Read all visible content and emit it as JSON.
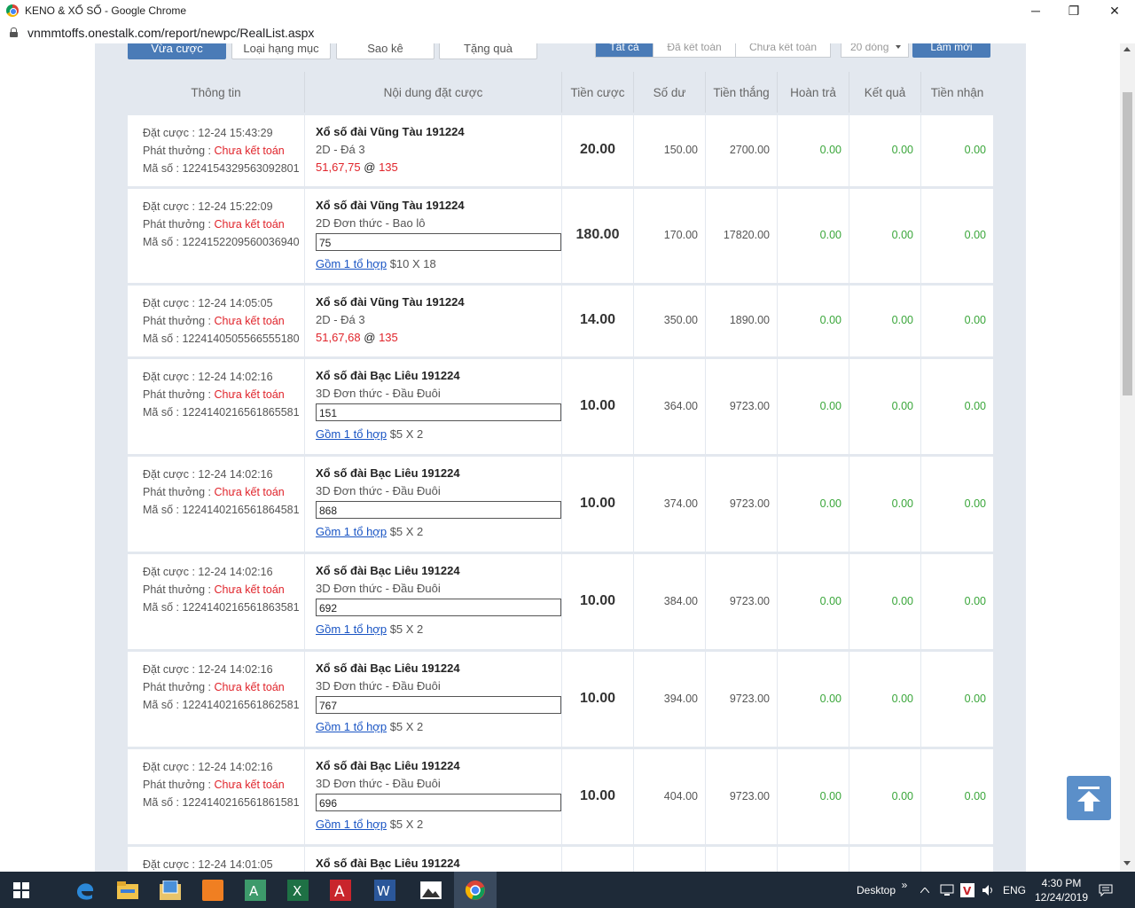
{
  "window": {
    "title": "KENO & XỔ SỐ - Google Chrome",
    "minimize": "─",
    "restore": "❐",
    "close": "✕"
  },
  "address": {
    "url": "vnmmtoffs.onestalk.com/report/newpc/RealList.aspx"
  },
  "toolbar": {
    "buttons": [
      "Vừa cược",
      "Loại hạng mục",
      "Sao kê",
      "Tặng quà"
    ],
    "filters": [
      "Tất cả",
      "Đã kết toán",
      "Chưa kết toán"
    ],
    "page_size": "20 dòng",
    "refresh": "Làm mới"
  },
  "table": {
    "headers": [
      "Thông tin",
      "Nội dung đặt cược",
      "Tiền cược",
      "Số dư",
      "Tiền thắng",
      "Hoàn trả",
      "Kết quả",
      "Tiền nhận"
    ],
    "labels": {
      "time": "Đặt cược : ",
      "payout": "Phát thưởng : ",
      "code": "Mã số : ",
      "unsettled": "Chưa kết toán",
      "at": "@",
      "combo": "Gồm 1 tổ hợp"
    },
    "rows": [
      {
        "time": "12-24 15:43:29",
        "code": "1224154329563092801",
        "title": "Xổ số đài Vũng Tàu 191224",
        "type": "2D - Đá 3",
        "numbers": "51,67,75",
        "odds": "135",
        "box": "",
        "combo_detail": "",
        "bet": "20.00",
        "balance": "150.00",
        "win": "2700.00",
        "refund": "0.00",
        "result": "0.00",
        "received": "0.00"
      },
      {
        "time": "12-24 15:22:09",
        "code": "1224152209560036940",
        "title": "Xổ số đài Vũng Tàu 191224",
        "type": "2D Đơn thức - Bao lô",
        "numbers": "",
        "odds": "",
        "box": "75",
        "combo_detail": "$10 X 18",
        "bet": "180.00",
        "balance": "170.00",
        "win": "17820.00",
        "refund": "0.00",
        "result": "0.00",
        "received": "0.00"
      },
      {
        "time": "12-24 14:05:05",
        "code": "1224140505566555180",
        "title": "Xổ số đài Vũng Tàu 191224",
        "type": "2D - Đá 3",
        "numbers": "51,67,68",
        "odds": "135",
        "box": "",
        "combo_detail": "",
        "bet": "14.00",
        "balance": "350.00",
        "win": "1890.00",
        "refund": "0.00",
        "result": "0.00",
        "received": "0.00"
      },
      {
        "time": "12-24 14:02:16",
        "code": "1224140216561865581",
        "title": "Xổ số đài Bạc Liêu 191224",
        "type": "3D Đơn thức - Đầu Đuôi",
        "numbers": "",
        "odds": "",
        "box": "151",
        "combo_detail": "$5 X 2",
        "bet": "10.00",
        "balance": "364.00",
        "win": "9723.00",
        "refund": "0.00",
        "result": "0.00",
        "received": "0.00"
      },
      {
        "time": "12-24 14:02:16",
        "code": "1224140216561864581",
        "title": "Xổ số đài Bạc Liêu 191224",
        "type": "3D Đơn thức - Đầu Đuôi",
        "numbers": "",
        "odds": "",
        "box": "868",
        "combo_detail": "$5 X 2",
        "bet": "10.00",
        "balance": "374.00",
        "win": "9723.00",
        "refund": "0.00",
        "result": "0.00",
        "received": "0.00"
      },
      {
        "time": "12-24 14:02:16",
        "code": "1224140216561863581",
        "title": "Xổ số đài Bạc Liêu 191224",
        "type": "3D Đơn thức - Đầu Đuôi",
        "numbers": "",
        "odds": "",
        "box": "692",
        "combo_detail": "$5 X 2",
        "bet": "10.00",
        "balance": "384.00",
        "win": "9723.00",
        "refund": "0.00",
        "result": "0.00",
        "received": "0.00"
      },
      {
        "time": "12-24 14:02:16",
        "code": "1224140216561862581",
        "title": "Xổ số đài Bạc Liêu 191224",
        "type": "3D Đơn thức - Đầu Đuôi",
        "numbers": "",
        "odds": "",
        "box": "767",
        "combo_detail": "$5 X 2",
        "bet": "10.00",
        "balance": "394.00",
        "win": "9723.00",
        "refund": "0.00",
        "result": "0.00",
        "received": "0.00"
      },
      {
        "time": "12-24 14:02:16",
        "code": "1224140216561861581",
        "title": "Xổ số đài Bạc Liêu 191224",
        "type": "3D Đơn thức - Đầu Đuôi",
        "numbers": "",
        "odds": "",
        "box": "696",
        "combo_detail": "$5 X 2",
        "bet": "10.00",
        "balance": "404.00",
        "win": "9723.00",
        "refund": "0.00",
        "result": "0.00",
        "received": "0.00"
      },
      {
        "time": "12-24 14:01:05",
        "code": "",
        "title": "Xổ số đài Bạc Liêu 191224",
        "type": "",
        "numbers": "",
        "odds": "",
        "box": "",
        "combo_detail": "",
        "bet": "",
        "balance": "",
        "win": "",
        "refund": "",
        "result": "",
        "received": ""
      }
    ]
  },
  "taskbar": {
    "desktop": "Desktop",
    "chevron": "»",
    "lang": "ENG",
    "time": "4:30 PM",
    "date": "12/24/2019",
    "colors": {
      "bg": "#1e2a38",
      "accent": "#4a7bb7",
      "green": "#3aa63a",
      "red": "#e0242b"
    }
  }
}
